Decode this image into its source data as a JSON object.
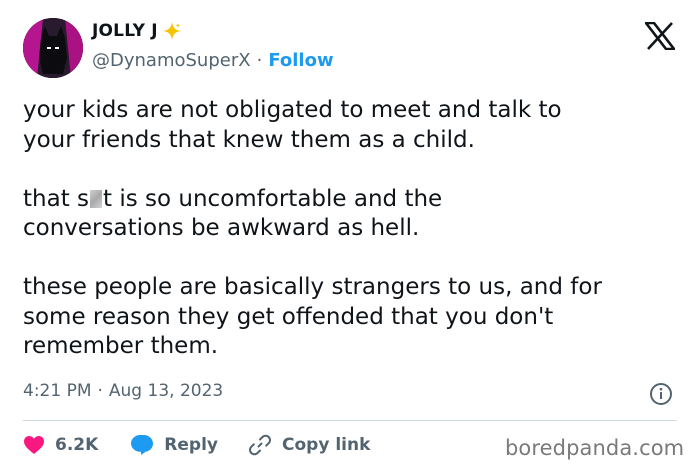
{
  "author": {
    "display_name": "JOLLY J",
    "handle": "@DynamoSuperX",
    "separator": "·",
    "follow_label": "Follow"
  },
  "tweet": {
    "paragraph1": "your kids are not obligated to meet and talk to\nyour friends that knew them as a child.",
    "paragraph2_before": "that s",
    "paragraph2_after": "t is so uncomfortable and the\nconversations be awkward as hell.",
    "paragraph3": "these people are basically strangers to us, and for\nsome reason they get offended that you don't\nremember them.",
    "time": "4:21 PM",
    "time_separator": "·",
    "date": "Aug 13, 2023"
  },
  "actions": {
    "like_count": "6.2K",
    "reply_label": "Reply",
    "copy_link_label": "Copy link"
  },
  "watermark": "boredpanda.com",
  "colors": {
    "accent": "#1d9bf0",
    "like": "#f91880",
    "reply": "#1d9bf0",
    "text": "#0f1419",
    "muted": "#536471",
    "sparkle": "#f5c400"
  },
  "icons": [
    "x-logo-icon",
    "sparkle-icon",
    "heart-icon",
    "reply-bubble-icon",
    "link-icon",
    "info-icon"
  ]
}
